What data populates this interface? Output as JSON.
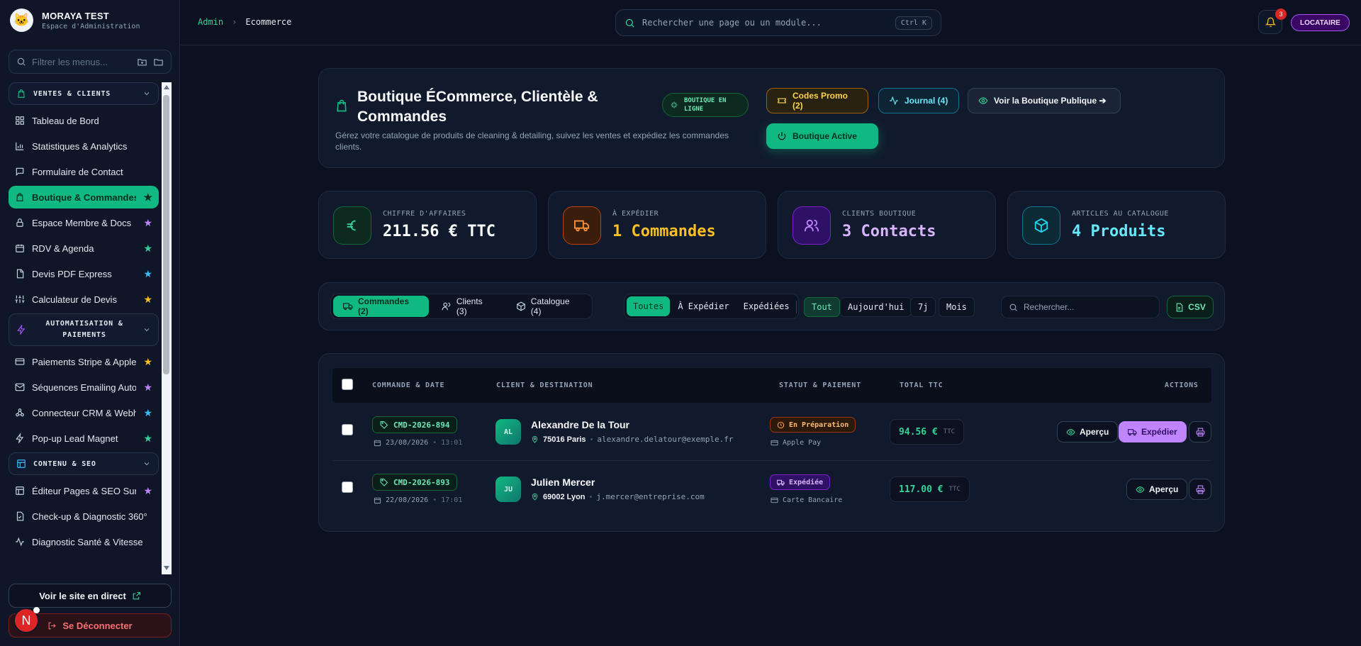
{
  "app": {
    "brand_title": "MORAYA TEST",
    "brand_subtitle": "Espace d'Administration",
    "logo_glyph": "🐱"
  },
  "sidebar": {
    "filter_placeholder": "Filtrer les menus...",
    "sections": [
      {
        "label": "VENTES & CLIENTS",
        "icon": "shopping-bag-icon"
      },
      {
        "label": "AUTOMATISATION & PAIEMENTS",
        "icon": "zap-icon"
      },
      {
        "label": "CONTENU & SEO",
        "icon": "layout-icon"
      }
    ],
    "items": [
      {
        "label": "Tableau de Bord",
        "icon": "grid-icon",
        "star": null
      },
      {
        "label": "Statistiques & Analytics",
        "icon": "bar-chart-icon",
        "star": null
      },
      {
        "label": "Formulaire de Contact",
        "icon": "message-icon",
        "star": null
      },
      {
        "label": "Boutique & Commandes",
        "icon": "shopping-bag-icon",
        "star": "#052e1f",
        "active": true
      },
      {
        "label": "Espace Membre & Docs",
        "icon": "lock-icon",
        "star": "#a855f7"
      },
      {
        "label": "RDV & Agenda",
        "icon": "calendar-icon",
        "star": "#34d399"
      },
      {
        "label": "Devis PDF Express",
        "icon": "file-icon",
        "star": "#38bdf8"
      },
      {
        "label": "Calculateur de Devis",
        "icon": "sliders-icon",
        "star": "#fbbf24"
      },
      {
        "label": "Paiements Stripe & Apple",
        "icon": "credit-card-icon",
        "star": "#fbbf24"
      },
      {
        "label": "Séquences Emailing Auto",
        "icon": "mail-icon",
        "star": "#a855f7"
      },
      {
        "label": "Connecteur CRM & Webh...",
        "icon": "webhook-icon",
        "star": "#38bdf8"
      },
      {
        "label": "Pop-up Lead Magnet",
        "icon": "zap-icon",
        "star": "#34d399"
      },
      {
        "label": "Éditeur Pages & SEO Sur-...",
        "icon": "layout-icon",
        "star": "#a855f7"
      },
      {
        "label": "Check-up & Diagnostic 360°",
        "icon": "file-check-icon",
        "star": null
      },
      {
        "label": "Diagnostic Santé & Vitesse",
        "icon": "activity-icon",
        "star": null
      }
    ],
    "site_button": "Voir le site en direct",
    "logout_button": "Se Déconnecter",
    "avatar_initial": "N"
  },
  "topbar": {
    "breadcrumb_root": "Admin",
    "breadcrumb_current": "Ecommerce",
    "search_placeholder": "Rechercher une page ou un module...",
    "search_shortcut": "Ctrl K",
    "notifications_count": "3",
    "role_badge": "LOCATAIRE"
  },
  "hero": {
    "title": "Boutique ÉCommerce, Clientèle & Commandes",
    "description": "Gérez votre catalogue de produits de cleaning & detailing, suivez les ventes et expédiez les commandes clients.",
    "online_badge": "BOUTIQUE EN LIGNE",
    "promo_button": "Codes Promo (2)",
    "journal_button": "Journal (4)",
    "public_button": "Voir la Boutique Publique ➔",
    "active_button": "Boutique Active"
  },
  "stats": [
    {
      "label": "CHIFFRE D'AFFAIRES",
      "value": "211.56 € TTC",
      "color": "#f8fafc",
      "icon": "euro-icon"
    },
    {
      "label": "À EXPÉDIER",
      "value": "1 Commandes",
      "color": "#fbbf24",
      "icon": "truck-icon"
    },
    {
      "label": "CLIENTS BOUTIQUE",
      "value": "3 Contacts",
      "color": "#d8b4fe",
      "icon": "users-icon"
    },
    {
      "label": "ARTICLES AU CATALOGUE",
      "value": "4 Produits",
      "color": "#67e8f9",
      "icon": "box-icon"
    }
  ],
  "toolbar": {
    "tabs": [
      "Commandes (2)",
      "Clients (3)",
      "Catalogue (4)"
    ],
    "status_filters": [
      "Toutes",
      "À Expédier",
      "Expédiées"
    ],
    "period_filters": [
      "Tout",
      "Aujourd'hui",
      "7j",
      "Mois"
    ],
    "search_placeholder": "Rechercher...",
    "csv_button": "CSV"
  },
  "table": {
    "headers": [
      "COMMANDE & DATE",
      "CLIENT & DESTINATION",
      "STATUT & PAIEMENT",
      "TOTAL TTC",
      "ACTIONS"
    ],
    "rows": [
      {
        "order": "CMD-2026-894",
        "date": "23/08/2026",
        "time": "13:01",
        "initials": "AL",
        "name": "Alexandre De la Tour",
        "city": "75016 Paris",
        "email": "alexandre.delatour@exemple.fr",
        "status": "En Préparation",
        "payment": "Apple Pay",
        "total": "94.56 €",
        "ttc": "TTC",
        "view": "Aperçu",
        "ship": "Expédier"
      },
      {
        "order": "CMD-2026-893",
        "date": "22/08/2026",
        "time": "17:01",
        "initials": "JU",
        "name": "Julien Mercer",
        "city": "69002 Lyon",
        "email": "j.mercer@entreprise.com",
        "status": "Expédiée",
        "payment": "Carte Bancaire",
        "total": "117.00 €",
        "ttc": "TTC",
        "view": "Aperçu"
      }
    ]
  }
}
